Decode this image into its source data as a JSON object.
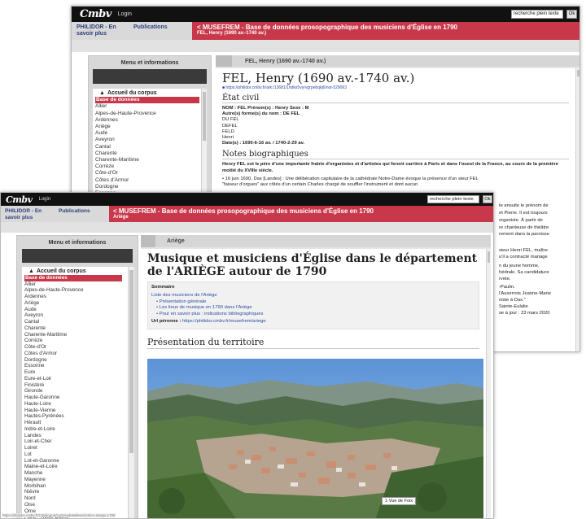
{
  "app": {
    "logo": "Cmbv",
    "login": "Login",
    "search_placeholder": "recherche plein texte",
    "ok_label": "Ok",
    "nav_home": "PHILIDOR - En savoir plus",
    "nav_publications": "Publications"
  },
  "back": {
    "title": "< MUSEFREM - Base de données prosopographique des musiciens d'Église en 1790",
    "subtitle": "FEL, Henry (1690 av.-1740 av.)",
    "menu_header": "Menu et informations",
    "content_header": "FEL, Henry (1690 av.-1740 av.)",
    "heading": "FEL, Henry (1690 av.-1740 av.)",
    "ark": "https://philidor.cmbv.fr/ark:/13681/1hdkx5vyrvgrpebqkj6/not-529063",
    "etat_civil": "État civil",
    "nom_line": "NOM : FEL    Prénom(s) : Henry    Sexe : M",
    "autres_formes": "Autre(s) forme(s) du nom : DE FEL",
    "variants": [
      "DU FEL",
      "DEFEL",
      "FELD",
      "Henri"
    ],
    "dates": "Date(s) : 1690-6-16 av.  / 1740-2-29 av.",
    "notes_title": "Notes biographiques",
    "bio_bold": "Henry FEL est le père d'une importante fratrie d'organistes et d'artistes qui feront carrière à Paris et dans l'ouest de la France, au cours de la première moitié du XVIIIe siècle.",
    "bio_1": "• 16 juin 1690, Dax [Landes] : Une délibération capitulaire de la cathédrale Notre-Dame évoque la présence d'un sieur FEL",
    "bio_2": "\"faiseur d'orgues\" aux côtés d'un certain Charles chargé de souffler l'instrument et dont aucun",
    "right_fragments": [
      "te ensuite le prénom de",
      "et Pierre. Il est toujours",
      "organiste. À partir de",
      "re chanteuse de théâtre",
      "rement dans la paroisse",
      "sieur Henri FEL, maître",
      "u'il a contracté mariage",
      "n du jeune homme.",
      "hédrale. Sa candidature",
      "rvete.",
      "-Paulin.",
      "l'Auxerrois Jeanne-Marie",
      "niste à Dax.\"",
      "Sainte-Eulalie",
      "se à jour : 23 mars 2020"
    ],
    "menu_home": "Accueil du corpus",
    "menu_db": "Base de données",
    "menu_items": [
      "Allier",
      "Alpes-de-Haute-Provence",
      "Ardennes",
      "Ariège",
      "Aude",
      "Aveyron",
      "Cantal",
      "Charente",
      "Charente-Maritime",
      "Corrèze",
      "Côte-d'Or",
      "Côtes d'Armor",
      "Dordogne",
      "Essonne"
    ]
  },
  "front": {
    "title": "< MUSEFREM - Base de données prosopographique des musiciens d'Église en 1790",
    "subtitle": "Ariège",
    "menu_header": "Menu et informations",
    "content_header": "Ariège",
    "heading": "Musique et musiciens d'Église dans le département de l'ARIÈGE autour de 1790",
    "sommaire_title": "Sommaire",
    "sommaire_list_link": "Liste des musiciens de l'Ariège",
    "sommaire_items": [
      "Présentation générale",
      "Les lieux de musique en 1790 dans l'Ariège",
      "Pour en savoir plus : indications bibliographiques"
    ],
    "url_label": "Url pérenne : ",
    "url_value": "https://philidor.cmbv.fr/musefrem/ariege",
    "section_title": "Présentation du territoire",
    "photo_caption": "1-Vue de Foix",
    "status_url": "https://philidor.cmbv.fr/Catalogue/noticesdetaillees/notice-ariege-1788",
    "menu_home": "Accueil du corpus",
    "menu_db": "Base de données",
    "menu_items": [
      "Allier",
      "Alpes-de-Haute-Provence",
      "Ardennes",
      "Ariège",
      "Aude",
      "Aveyron",
      "Cantal",
      "Charente",
      "Charente-Maritime",
      "Corrèze",
      "Côte-d'Or",
      "Côtes d'Armor",
      "Dordogne",
      "Essonne",
      "Eure",
      "Eure-et-Loir",
      "Finistère",
      "Gironde",
      "Haute-Garonne",
      "Haute-Loire",
      "Haute-Vienne",
      "Hautes-Pyrénées",
      "Hérault",
      "Indre-et-Loire",
      "Landes",
      "Loir-et-Cher",
      "Loiret",
      "Lot",
      "Lot-et-Garonne",
      "Maine-et-Loire",
      "Manche",
      "Mayenne",
      "Morbihan",
      "Nièvre",
      "Nord",
      "Oise",
      "Orne",
      "Paris - Notre-Dame"
    ]
  },
  "colors": {
    "accent_red": "#c8384a",
    "topbar": "#111111",
    "link_blue": "#2a4da6"
  }
}
